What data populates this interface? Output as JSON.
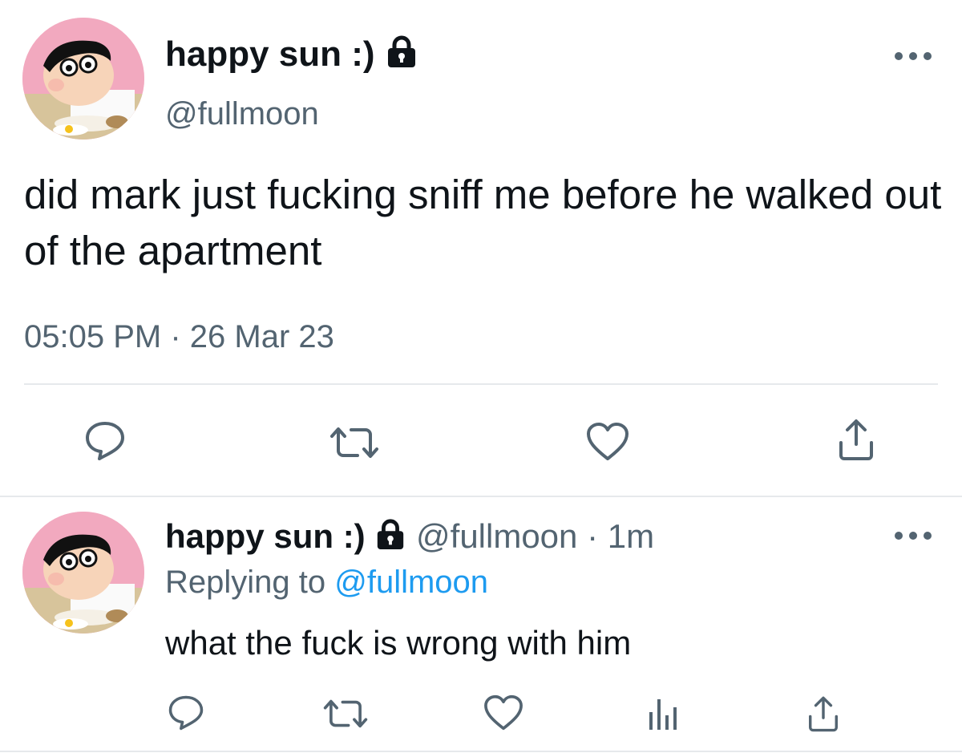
{
  "main_tweet": {
    "display_name": "happy sun :)",
    "handle": "@fullmoon",
    "text": "did mark just fucking sniff me before he walked out of the apartment",
    "time": "05:05 PM",
    "separator": "·",
    "date": "26 Mar 23"
  },
  "reply_tweet": {
    "display_name": "happy sun :)",
    "handle": "@fullmoon",
    "separator": "·",
    "age": "1m",
    "replying_label": "Replying to",
    "replying_to": "@fullmoon",
    "text": "what the fuck is wrong with him"
  },
  "icons": {
    "lock": "lock-icon",
    "more": "more-icon",
    "reply": "reply-icon",
    "retweet": "retweet-icon",
    "like": "heart-icon",
    "share": "share-icon",
    "analytics": "analytics-icon"
  },
  "colors": {
    "text": "#0f1419",
    "muted": "#536471",
    "link": "#1d9bf0",
    "divider": "#e6e9ec"
  }
}
